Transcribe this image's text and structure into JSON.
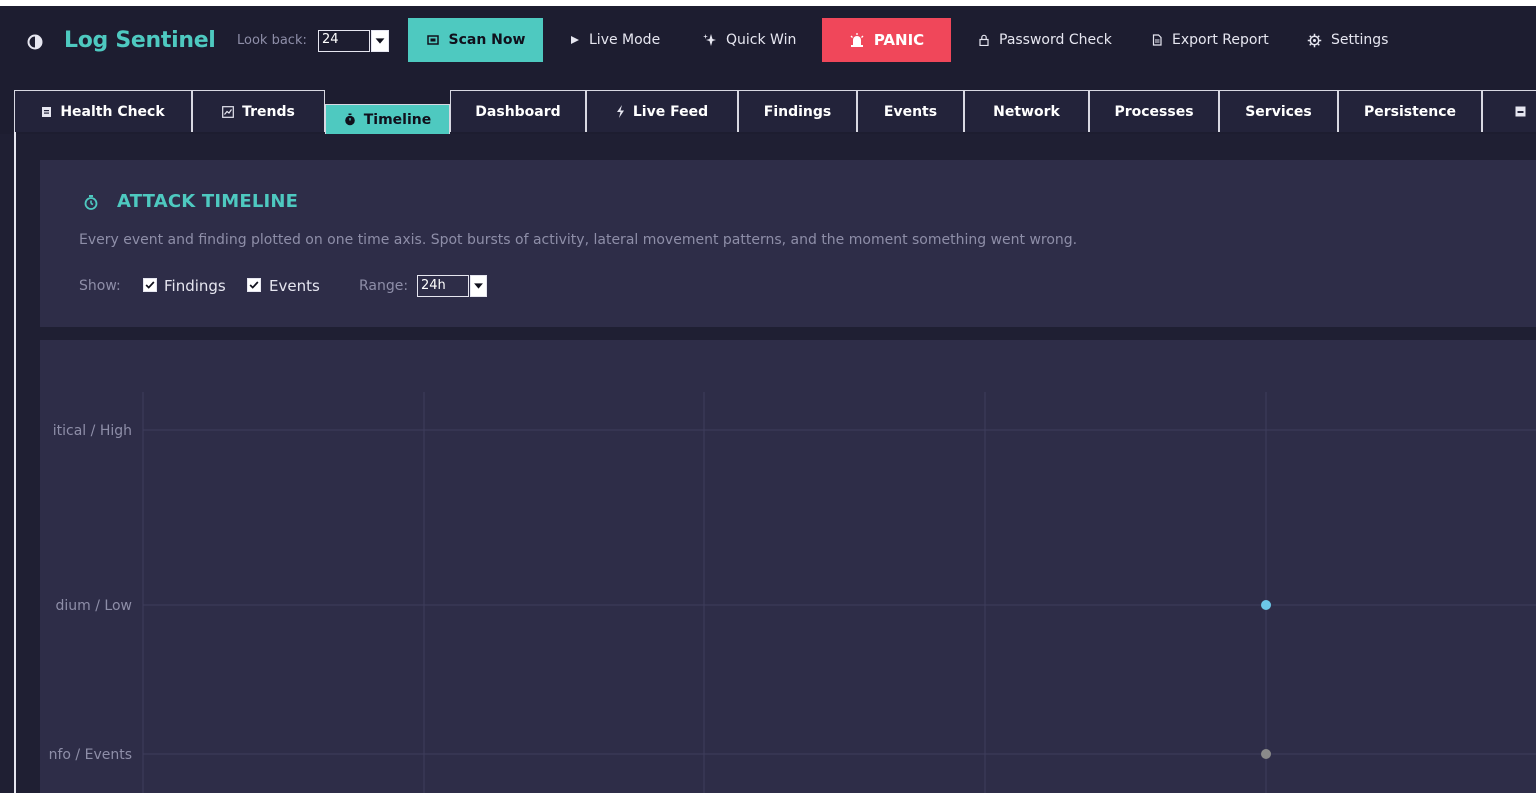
{
  "toolbar": {
    "app_title": "Log Sentinel",
    "lookback_label": "Look back:",
    "lookback_value": "24",
    "scan_label": "Scan Now",
    "live_label": "Live Mode",
    "quickwin_label": "Quick Win",
    "panic_label": "PANIC",
    "password_label": "Password Check",
    "export_label": "Export Report",
    "settings_label": "Settings"
  },
  "tabs": [
    {
      "label": "Health Check",
      "icon": "clipboard-icon"
    },
    {
      "label": "Trends",
      "icon": "chart-icon"
    },
    {
      "label": "Timeline",
      "icon": "stopwatch-icon",
      "active": true
    },
    {
      "label": "Dashboard"
    },
    {
      "label": "Live Feed",
      "icon": "lightning-icon"
    },
    {
      "label": "Findings"
    },
    {
      "label": "Events"
    },
    {
      "label": "Network"
    },
    {
      "label": "Processes"
    },
    {
      "label": "Services"
    },
    {
      "label": "Persistence"
    },
    {
      "label": "",
      "icon": "inbox-icon"
    }
  ],
  "timeline": {
    "title": "ATTACK TIMELINE",
    "description": "Every event and finding plotted on one time axis. Spot bursts of activity, lateral movement patterns, and the moment something went wrong.",
    "show_label": "Show:",
    "findings_label": "Findings",
    "events_label": "Events",
    "range_label": "Range:",
    "range_value": "24h"
  },
  "chart_data": {
    "type": "scatter",
    "categories": [
      "itical / High",
      "dium / Low",
      "nfo / Events"
    ],
    "points": [
      {
        "category": "dium / Low",
        "series": "Findings",
        "color": "#6cc7e8"
      },
      {
        "category": "nfo / Events",
        "series": "Events",
        "color": "#8a8a8a"
      }
    ]
  },
  "colors": {
    "accent": "#4ec9c0",
    "panic": "#f0475a",
    "card": "#2e2d48",
    "background": "#1f1f33"
  }
}
